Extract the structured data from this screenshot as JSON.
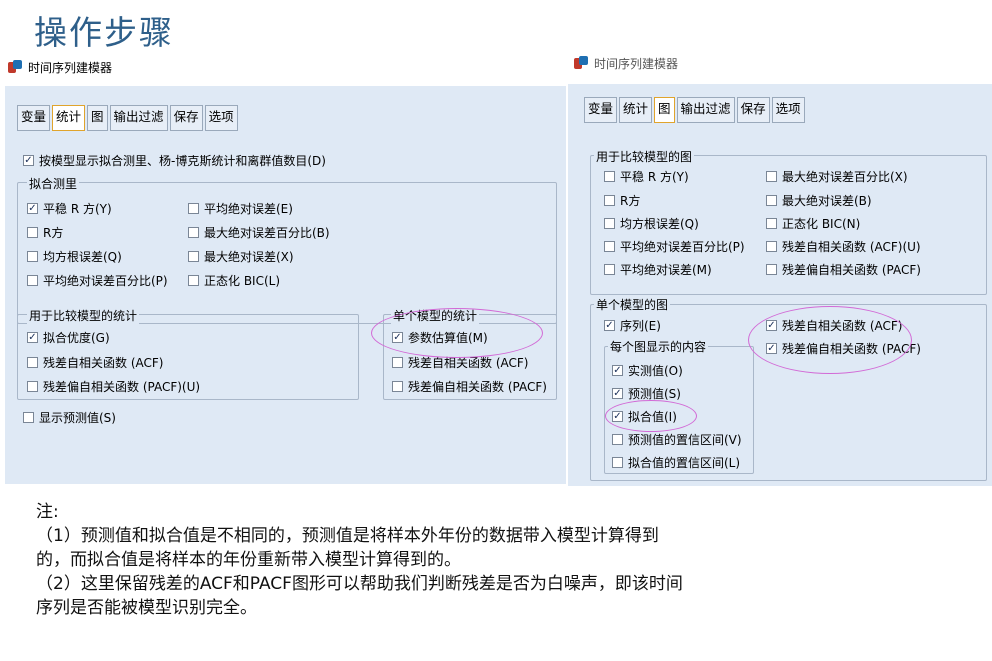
{
  "slide_title": "操作步骤",
  "left_window": {
    "title": "时间序列建模器",
    "tabs": [
      "变量",
      "统计",
      "图",
      "输出过滤",
      "保存",
      "选项"
    ],
    "active_tab": "统计",
    "display_fit": {
      "label": "按模型显示拟合测里、杨-博克斯统计和离群值数目(D)",
      "checked": true
    },
    "fit_measures": {
      "title": "拟合测里",
      "items": [
        {
          "label": "平稳 R 方(Y)",
          "checked": true
        },
        {
          "label": "平均绝对误差(E)",
          "checked": false
        },
        {
          "label": "R方",
          "checked": false
        },
        {
          "label": "最大绝对误差百分比(B)",
          "checked": false
        },
        {
          "label": "均方根误差(Q)",
          "checked": false
        },
        {
          "label": "最大绝对误差(X)",
          "checked": false
        },
        {
          "label": "平均绝对误差百分比(P)",
          "checked": false
        },
        {
          "label": "正态化 BIC(L)",
          "checked": false
        }
      ]
    },
    "compare_stats": {
      "title": "用于比较模型的统计",
      "items": [
        {
          "label": "拟合优度(G)",
          "checked": true
        },
        {
          "label": "残差自相关函数 (ACF)",
          "checked": false
        },
        {
          "label": "残差偏自相关函数 (PACF)(U)",
          "checked": false
        }
      ]
    },
    "single_model_stats": {
      "title": "单个模型的统计",
      "items": [
        {
          "label": "参数估算值(M)",
          "checked": true
        },
        {
          "label": "残差自相关函数 (ACF)",
          "checked": false
        },
        {
          "label": "残差偏自相关函数 (PACF)",
          "checked": false
        }
      ]
    },
    "show_forecast": {
      "label": "显示预测值(S)",
      "checked": false
    }
  },
  "right_window": {
    "title": "时间序列建模器",
    "tabs": [
      "变量",
      "统计",
      "图",
      "输出过滤",
      "保存",
      "选项"
    ],
    "active_tab": "图",
    "compare_plots": {
      "title": "用于比较模型的图",
      "items": [
        {
          "label": "平稳 R 方(Y)",
          "checked": false
        },
        {
          "label": "最大绝对误差百分比(X)",
          "checked": false
        },
        {
          "label": "R方",
          "checked": false
        },
        {
          "label": "最大绝对误差(B)",
          "checked": false
        },
        {
          "label": "均方根误差(Q)",
          "checked": false
        },
        {
          "label": "正态化 BIC(N)",
          "checked": false
        },
        {
          "label": "平均绝对误差百分比(P)",
          "checked": false
        },
        {
          "label": "残差自相关函数 (ACF)(U)",
          "checked": false
        },
        {
          "label": "平均绝对误差(M)",
          "checked": false
        },
        {
          "label": "残差偏自相关函数 (PACF)",
          "checked": false
        }
      ]
    },
    "single_plots": {
      "title": "单个模型的图",
      "series": {
        "label": "序列(E)",
        "checked": true
      },
      "residual_acf": {
        "label": "残差自相关函数 (ACF)",
        "checked": true
      },
      "residual_pacf": {
        "label": "残差偏自相关函数 (PACF)",
        "checked": true
      },
      "content_title": "每个图显示的内容",
      "content_items": [
        {
          "label": "实测值(O)",
          "checked": true
        },
        {
          "label": "预测值(S)",
          "checked": true
        },
        {
          "label": "拟合值(I)",
          "checked": true
        },
        {
          "label": "预测值的置信区间(V)",
          "checked": false
        },
        {
          "label": "拟合值的置信区间(L)",
          "checked": false
        }
      ]
    }
  },
  "notes": {
    "heading": "注:",
    "line1": "（1）预测值和拟合值是不相同的，预测值是将样本外年份的数据带入模型计算得到",
    "line2": "的，而拟合值是将样本的年份重新带入模型计算得到的。",
    "line3": "（2）这里保留残差的ACF和PACF图形可以帮助我们判断残差是否为白噪声，即该时间",
    "line4": "序列是否能被模型识别完全。"
  },
  "colors": {
    "title_blue": "#2e5f8a",
    "panel_bg": "#dfe9f5",
    "highlight_oval": "#d26ad6",
    "active_tab_border": "#e0a42c"
  }
}
